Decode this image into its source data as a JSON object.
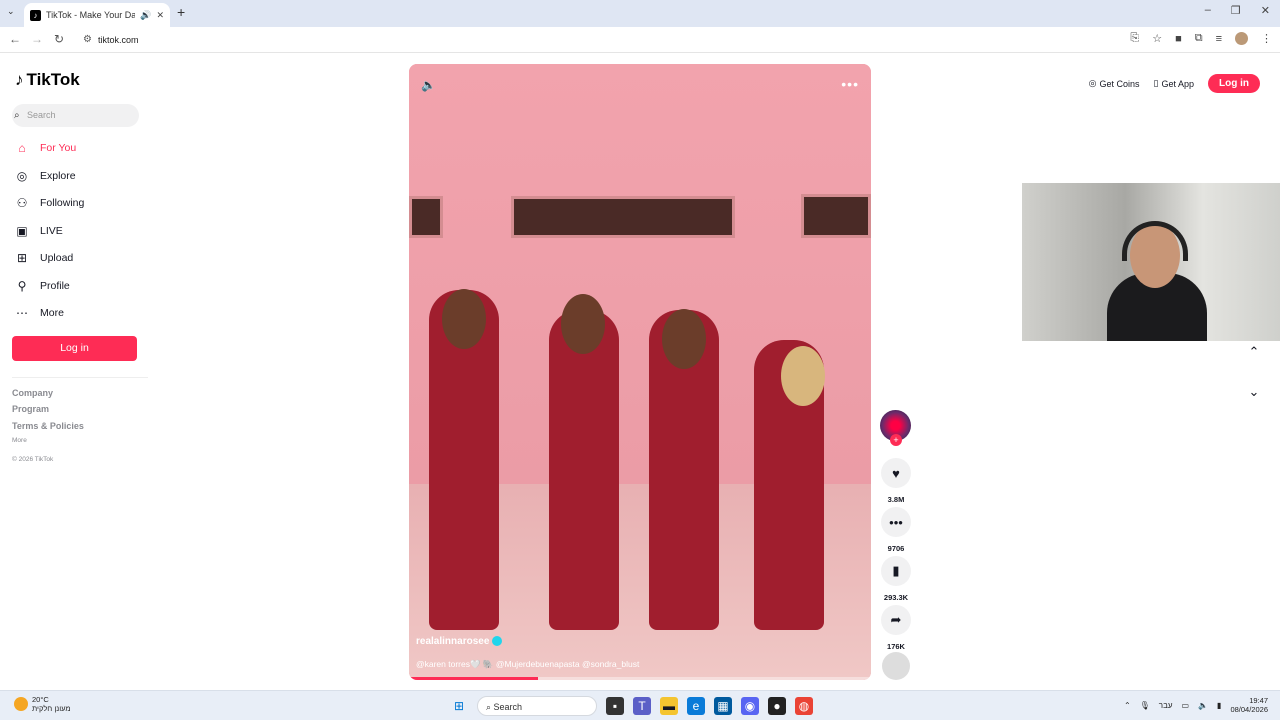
{
  "browser": {
    "tab_title": "TikTok - Make Your Day",
    "url": "tiktok.com"
  },
  "sidebar": {
    "logo": "TikTok",
    "search_placeholder": "Search",
    "items": [
      {
        "label": "For You",
        "icon": "home-icon"
      },
      {
        "label": "Explore",
        "icon": "compass-icon"
      },
      {
        "label": "Following",
        "icon": "following-icon"
      },
      {
        "label": "LIVE",
        "icon": "live-icon"
      },
      {
        "label": "Upload",
        "icon": "upload-icon"
      },
      {
        "label": "Profile",
        "icon": "profile-icon"
      },
      {
        "label": "More",
        "icon": "more-icon"
      }
    ],
    "login_label": "Log in",
    "footer": {
      "company": "Company",
      "program": "Program",
      "terms": "Terms & Policies",
      "more": "More",
      "copyright": "© 2026 TikTok"
    }
  },
  "video": {
    "author": "realalinnarosee",
    "caption": "@karen torres🤍 🐘 @Mujerdebuenapasta @sondra_blust",
    "progress": 0.28
  },
  "actions": {
    "likes": "3.8M",
    "comments": "9706",
    "saves": "293.3K",
    "shares": "176K"
  },
  "header": {
    "get_coins": "Get Coins",
    "get_app": "Get App",
    "login": "Log in"
  },
  "taskbar": {
    "temperature": "20°C",
    "weather_text": "מעונן חלקית",
    "search": "Search",
    "lang": "עבר",
    "time": "19:47",
    "date": "08/04/2026"
  },
  "colors": {
    "accent": "#fe2c55"
  }
}
